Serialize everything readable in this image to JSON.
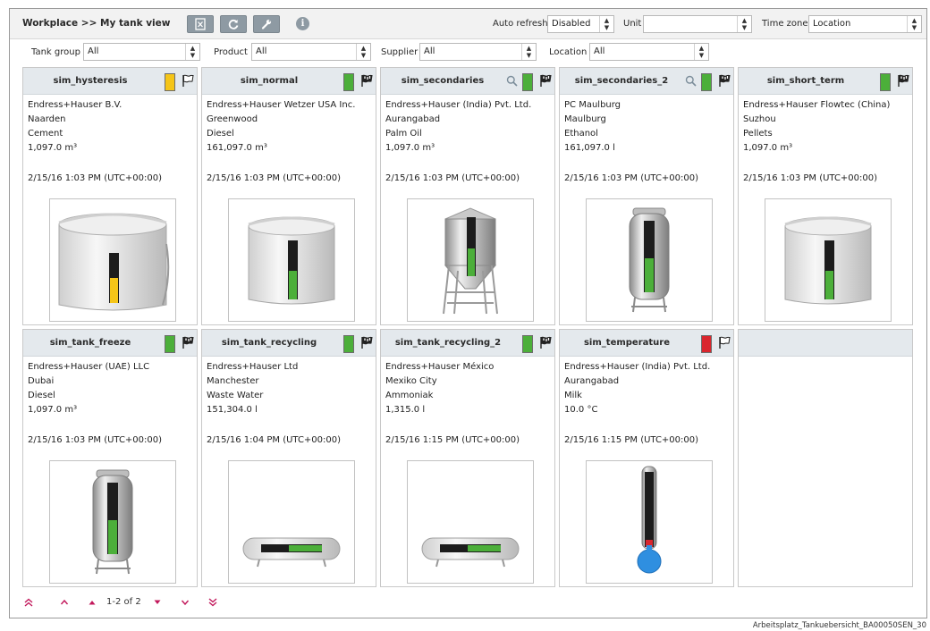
{
  "header": {
    "title": "Workplace >> My tank view",
    "auto_refresh_label": "Auto refresh",
    "auto_refresh_value": "Disabled",
    "unit_label": "Unit",
    "unit_value": "",
    "timezone_label": "Time zone",
    "timezone_value": "Location"
  },
  "filters": {
    "tank_group_label": "Tank group",
    "tank_group_value": "All",
    "product_label": "Product",
    "product_value": "All",
    "supplier_label": "Supplier",
    "supplier_value": "All",
    "location_label": "Location",
    "location_value": "All"
  },
  "colors": {
    "ok": "#4caf3a",
    "warning": "#f5c518",
    "alarm": "#d9262e",
    "magenta": "#c2185b"
  },
  "icons": {
    "export": "excel-export-icon",
    "refresh": "refresh-icon",
    "settings": "wrench-icon",
    "info": "info-icon",
    "flag": "checkered-flag-icon",
    "search": "magnifier-icon"
  },
  "tanks": [
    {
      "name": "sim_hysteresis",
      "company": "Endress+Hauser B.V.",
      "city": "Naarden",
      "product": "Cement",
      "volume": "1,097.0 m³",
      "timestamp": "2/15/16 1:03 PM (UTC+00:00)",
      "status": "warning",
      "flag": "outline",
      "search": false,
      "shape": "silo_big",
      "level": 0.5
    },
    {
      "name": "sim_normal",
      "company": "Endress+Hauser Wetzer USA Inc.",
      "city": "Greenwood",
      "product": "Diesel",
      "volume": "161,097.0 m³",
      "timestamp": "2/15/16 1:03 PM (UTC+00:00)",
      "status": "ok",
      "flag": "filled",
      "search": false,
      "shape": "silo",
      "level": 0.48
    },
    {
      "name": "sim_secondaries",
      "company": "Endress+Hauser (India) Pvt. Ltd.",
      "city": "Aurangabad",
      "product": "Palm Oil",
      "volume": "1,097.0 m³",
      "timestamp": "2/15/16 1:03 PM (UTC+00:00)",
      "status": "ok",
      "flag": "filled",
      "search": true,
      "shape": "hopper",
      "level": 0.47
    },
    {
      "name": "sim_secondaries_2",
      "company": "PC Maulburg",
      "city": "Maulburg",
      "product": "Ethanol",
      "volume": "161,097.0 l",
      "timestamp": "2/15/16 1:03 PM (UTC+00:00)",
      "status": "ok",
      "flag": "filled",
      "search": true,
      "shape": "vessel",
      "level": 0.48
    },
    {
      "name": "sim_short_term",
      "company": "Endress+Hauser Flowtec (China)",
      "city": "Suzhou",
      "product": "Pellets",
      "volume": "1,097.0 m³",
      "timestamp": "2/15/16 1:03 PM (UTC+00:00)",
      "status": "ok",
      "flag": "filled",
      "search": false,
      "shape": "silo",
      "level": 0.48
    },
    {
      "name": "sim_tank_freeze",
      "company": "Endress+Hauser (UAE) LLC",
      "city": "Dubai",
      "product": "Diesel",
      "volume": "1,097.0 m³",
      "timestamp": "2/15/16 1:03 PM (UTC+00:00)",
      "status": "ok",
      "flag": "filled",
      "search": false,
      "shape": "vessel",
      "level": 0.48
    },
    {
      "name": "sim_tank_recycling",
      "company": "Endress+Hauser Ltd",
      "city": "Manchester",
      "product": "Waste Water",
      "volume": "151,304.0 l",
      "timestamp": "2/15/16 1:04 PM (UTC+00:00)",
      "status": "ok",
      "flag": "filled",
      "search": false,
      "shape": "horizontal",
      "level": 0.55
    },
    {
      "name": "sim_tank_recycling_2",
      "company": "Endress+Hauser México",
      "city": "Mexiko City",
      "product": "Ammoniak",
      "volume": "1,315.0 l",
      "timestamp": "2/15/16 1:15 PM (UTC+00:00)",
      "status": "ok",
      "flag": "filled",
      "search": false,
      "shape": "horizontal",
      "level": 0.55
    },
    {
      "name": "sim_temperature",
      "company": "Endress+Hauser (India) Pvt. Ltd.",
      "city": "Aurangabad",
      "product": "Milk",
      "volume": "10.0 °C",
      "timestamp": "2/15/16 1:15 PM (UTC+00:00)",
      "status": "alarm",
      "flag": "outline",
      "search": false,
      "shape": "thermometer",
      "level": 0.1
    }
  ],
  "pager": {
    "range": "1-2 of 2"
  },
  "caption": "Arbeitsplatz_Tankuebersicht_BA00050SEN_30"
}
